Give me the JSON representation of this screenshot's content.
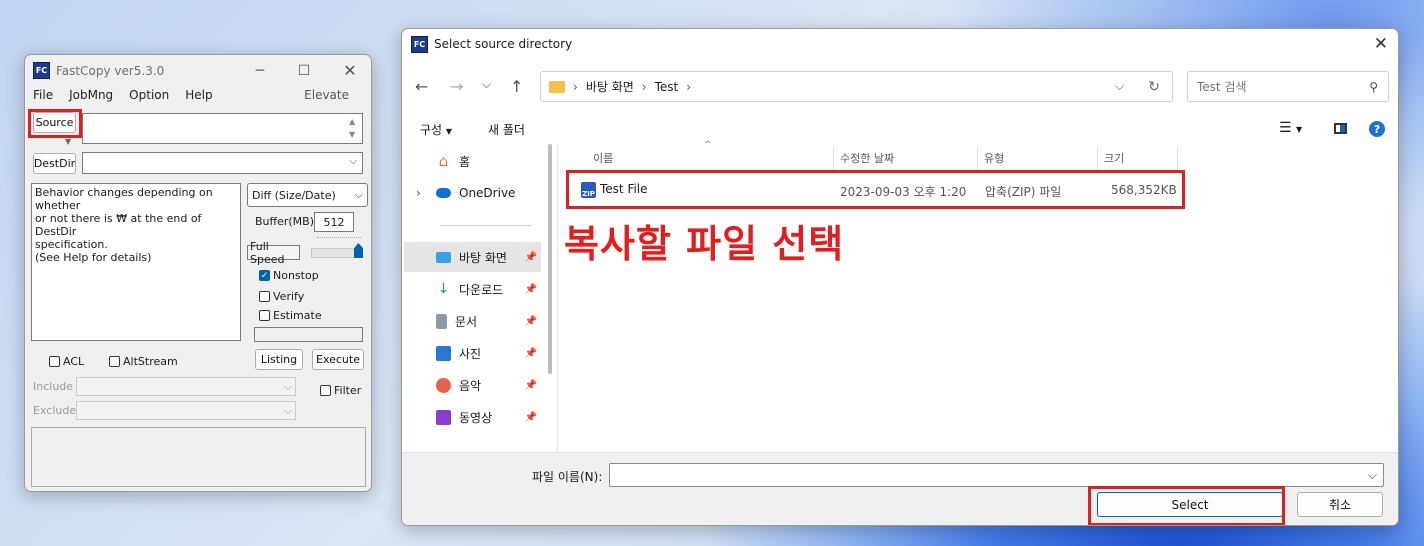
{
  "fastcopy": {
    "title": "FastCopy ver5.3.0",
    "icon_text": "FC",
    "menu": [
      "File",
      "JobMng",
      "Option",
      "Help"
    ],
    "menu_right": "Elevate",
    "source_label": "Source",
    "destdir_label": "DestDir",
    "description_lines": [
      "Behavior changes depending on whether",
      "or not there is ₩ at the end of DestDir",
      "specification.",
      "(See Help for details)"
    ],
    "mode_value": "Diff (Size/Date)",
    "buffer_label": "Buffer(MB)",
    "buffer_value": "512",
    "speed_label": "Full Speed",
    "speed_fraction": 1.0,
    "options": [
      {
        "label": "Nonstop",
        "checked": true
      },
      {
        "label": "Verify",
        "checked": false
      },
      {
        "label": "Estimate",
        "checked": false
      }
    ],
    "acl_label": "ACL",
    "altstream_label": "AltStream",
    "listing_label": "Listing",
    "execute_label": "Execute",
    "include_label": "Include",
    "exclude_label": "Exclude",
    "filter_label": "Filter"
  },
  "dialog": {
    "title": "Select source directory",
    "breadcrumb": [
      "바탕 화면",
      "Test"
    ],
    "search_placeholder": "Test 검색",
    "toolbar": {
      "organize": "구성",
      "new_folder": "새 폴더"
    },
    "nav_items": [
      {
        "label": "홈",
        "icon": "home-icon"
      },
      {
        "label": "OneDrive",
        "icon": "onedrive-icon"
      },
      {
        "label": "바탕 화면",
        "icon": "desktop-icon"
      },
      {
        "label": "다운로드",
        "icon": "download-icon"
      },
      {
        "label": "문서",
        "icon": "document-icon"
      },
      {
        "label": "사진",
        "icon": "pictures-icon"
      },
      {
        "label": "음악",
        "icon": "music-icon"
      },
      {
        "label": "동영상",
        "icon": "video-icon"
      }
    ],
    "columns": [
      "이름",
      "수정한 날짜",
      "유형",
      "크기"
    ],
    "files": [
      {
        "name": "Test File",
        "date": "2023-09-03 오후 1:20",
        "type": "압축(ZIP) 파일",
        "size": "568,352KB"
      }
    ],
    "filename_label": "파일 이름(N):",
    "select_label": "Select",
    "cancel_label": "취소"
  },
  "annotation": "복사할 파일 선택",
  "colors": {
    "highlight": "#e02020",
    "accent": "#0063b1"
  }
}
